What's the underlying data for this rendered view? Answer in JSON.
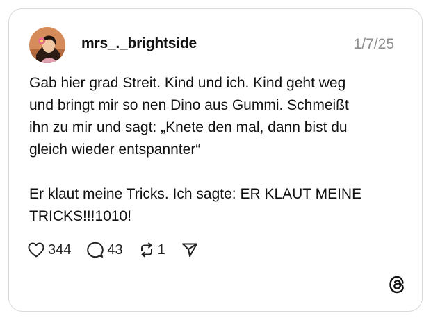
{
  "post": {
    "username": "mrs_._brightside",
    "date": "1/7/25",
    "text": "Gab hier grad Streit. Kind und ich. Kind geht weg\nund bringt mir so nen Dino aus Gummi. Schmeißt\nihn zu mir und sagt: „Knete den mal, dann bist du\ngleich wieder entspannter“\n\nEr klaut meine Tricks. Ich sagte: ER KLAUT MEINE\nTRICKS!!!1010!"
  },
  "actions": {
    "likes": "344",
    "replies": "43",
    "reposts": "1"
  },
  "icons": {
    "like": "heart-icon",
    "reply": "comment-icon",
    "repost": "repost-icon",
    "share": "send-icon",
    "brand": "threads-logo-icon"
  }
}
